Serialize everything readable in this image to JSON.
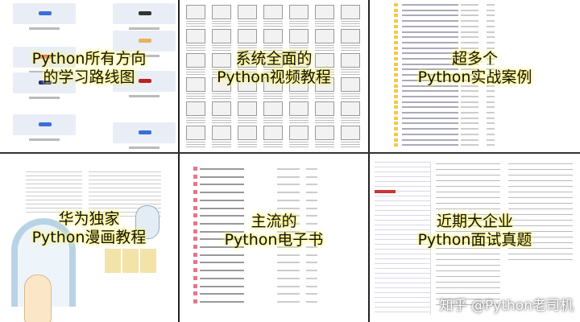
{
  "panels": [
    {
      "caption_line1": "Python所有方向",
      "caption_line2": "的学习路线图"
    },
    {
      "caption_line1": "系统全面的",
      "caption_line2": "Python视频教程"
    },
    {
      "caption_line1": "超多个",
      "caption_line2": "Python实战案例"
    },
    {
      "caption_line1": "华为独家",
      "caption_line2": "Python漫画教程"
    },
    {
      "caption_line1": "主流的",
      "caption_line2": "Python电子书"
    },
    {
      "caption_line1": "近期大企业",
      "caption_line2": "Python面试真题"
    }
  ],
  "watermark": "知乎 @Python老司机",
  "colors": {
    "highlight": "#fff36a",
    "folder": "#f3c84a",
    "pdf": "#e5778b"
  }
}
